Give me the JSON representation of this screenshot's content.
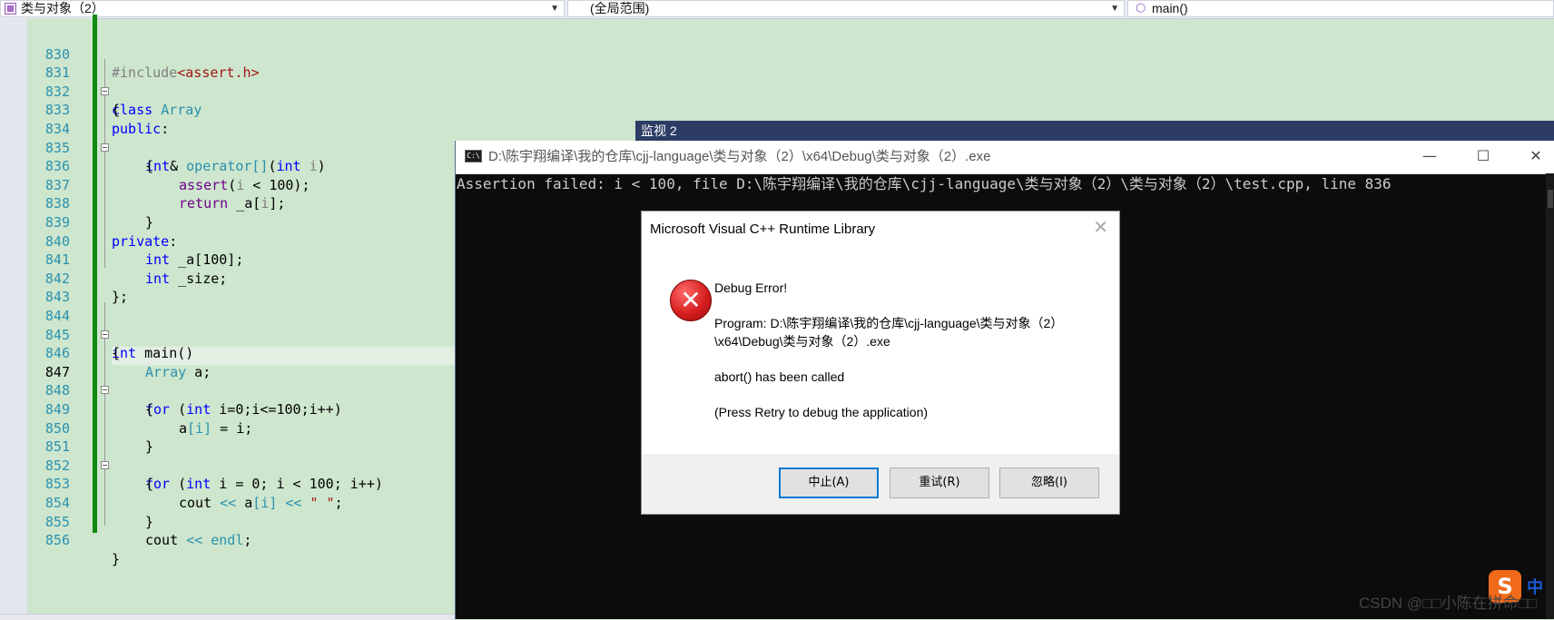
{
  "navbar": {
    "project": "类与对象（2）",
    "scope": "(全局范围)",
    "member": "main()",
    "project_icon": "class-icon",
    "member_icon": "cube-icon"
  },
  "editor": {
    "lines": [
      {
        "n": "830"
      },
      {
        "n": "831"
      },
      {
        "n": "832"
      },
      {
        "n": "833"
      },
      {
        "n": "834"
      },
      {
        "n": "835"
      },
      {
        "n": "836"
      },
      {
        "n": "837"
      },
      {
        "n": "838"
      },
      {
        "n": "839"
      },
      {
        "n": "840"
      },
      {
        "n": "841"
      },
      {
        "n": "842"
      },
      {
        "n": "843"
      },
      {
        "n": "844"
      },
      {
        "n": "845"
      },
      {
        "n": "846"
      },
      {
        "n": "847"
      },
      {
        "n": "848"
      },
      {
        "n": "849"
      },
      {
        "n": "850"
      },
      {
        "n": "851"
      },
      {
        "n": "852"
      },
      {
        "n": "853"
      },
      {
        "n": "854"
      },
      {
        "n": "855"
      },
      {
        "n": "856"
      }
    ],
    "code": {
      "l830": "#include",
      "l830b": "<assert.h>",
      "l831a": "class",
      "l831b": "Array",
      "l832": "{",
      "l833a": "public",
      "l833b": ":",
      "l834a": "int",
      "l834b": "&",
      "l834c": "operator[]",
      "l834d": "(",
      "l834e": "int",
      "l834f": "i",
      "l834g": ")",
      "l835": "{",
      "l836a": "assert",
      "l836b": "(",
      "l836c": "i",
      "l836d": " < 100);",
      "l837a": "return",
      "l837b": " _a[",
      "l837c": "i",
      "l837d": "];",
      "l838": "}",
      "l839a": "private",
      "l839b": ":",
      "l840a": "int",
      "l840b": " _a[100];",
      "l841a": "int",
      "l841b": " _size;",
      "l842": "};",
      "l844a": "int",
      "l844b": " main()",
      "l845": "{",
      "l846a": "Array",
      "l846b": " a;",
      "l847a": "for",
      "l847b": " (",
      "l847c": "int",
      "l847d": " i=0;i<=100;i++)",
      "l848": "{",
      "l849a": "a",
      "l849b": "[i]",
      "l849c": " = i;",
      "l850": "}",
      "l851a": "for",
      "l851b": " (",
      "l851c": "int",
      "l851d": " i = 0; i < 100; i++)",
      "l852": "{",
      "l853a": "cout",
      "l853b": " << ",
      "l853c": "a",
      "l853d": "[i]",
      "l853e": " << ",
      "l853f": "\" \"",
      "l853g": ";",
      "l854": "}",
      "l855a": "cout",
      "l855b": " << ",
      "l855c": "endl",
      "l855d": ";",
      "l856": "}"
    }
  },
  "watch": {
    "title": "监视 2"
  },
  "console": {
    "title": "D:\\陈宇翔编译\\我的仓库\\cjj-language\\类与对象（2）\\x64\\Debug\\类与对象（2）.exe",
    "icon_label": "C:\\",
    "output": "Assertion failed: i < 100, file D:\\陈宇翔编译\\我的仓库\\cjj-language\\类与对象（2）\\类与对象（2）\\test.cpp, line 836",
    "minimize": "—",
    "maximize": "☐",
    "close": "✕"
  },
  "dialog": {
    "title": "Microsoft Visual C++ Runtime Library",
    "close": "✕",
    "heading": "Debug Error!",
    "program_line1": "Program: D:\\陈宇翔编译\\我的仓库\\cjj-language\\类与对象（2）",
    "program_line2": "\\x64\\Debug\\类与对象（2）.exe",
    "message": "abort() has been called",
    "hint": "(Press Retry to debug the application)",
    "icon": "error-icon",
    "icon_glyph": "✕",
    "buttons": {
      "abort": "中止(A)",
      "retry": "重试(R)",
      "ignore": "忽略(I)"
    }
  },
  "overlay": {
    "ime_glyph": "S",
    "ime_lang": "中",
    "watermark": "CSDN @□□小陈在拼命□□"
  }
}
